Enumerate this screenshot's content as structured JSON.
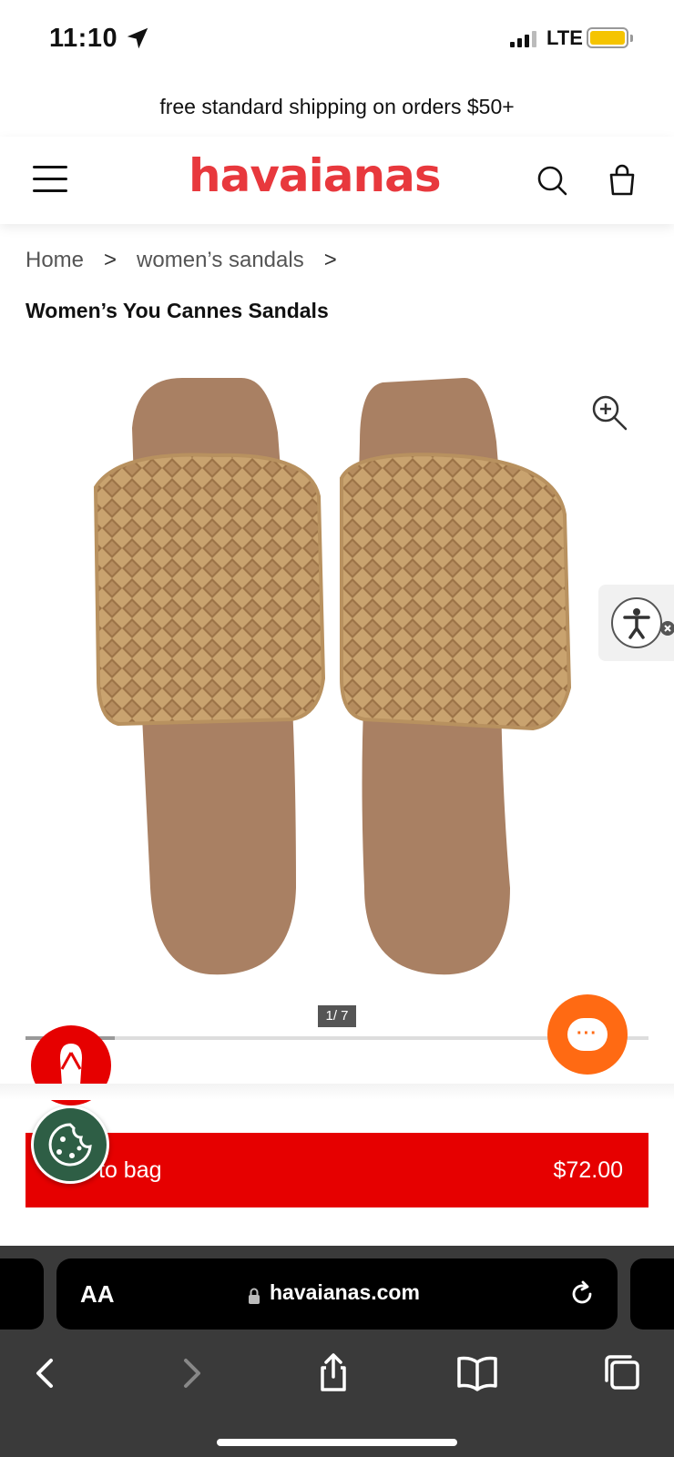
{
  "status_bar": {
    "time": "11:10",
    "network": "LTE",
    "icons": [
      "location-arrow-icon",
      "signal-icon",
      "battery-icon"
    ],
    "battery_color": "#f5c400"
  },
  "promo": {
    "text": "free standard shipping on orders $50+"
  },
  "header": {
    "logo": "havaianas",
    "logo_color": "#e8383d",
    "icons": [
      "hamburger-menu-icon",
      "search-icon",
      "shopping-bag-icon"
    ]
  },
  "breadcrumb": {
    "items": [
      "Home",
      "women’s sandals"
    ],
    "separator": ">"
  },
  "product": {
    "title": "Women’s You Cannes Sandals",
    "image_counter": "1/ 7",
    "image_index": 1,
    "image_total": 7
  },
  "cta": {
    "label": "to bag",
    "price": "$72.00",
    "color": "#e60000"
  },
  "browser": {
    "aa_label": "AA",
    "url": "havaianas.com",
    "icons": [
      "lock-icon",
      "reload-icon",
      "back-icon",
      "forward-icon",
      "share-icon",
      "bookmarks-icon",
      "tabs-icon"
    ]
  },
  "floating": {
    "chat_color": "#ff6a13",
    "cookie_color": "#2e5e45",
    "badge_color": "#e60000"
  }
}
